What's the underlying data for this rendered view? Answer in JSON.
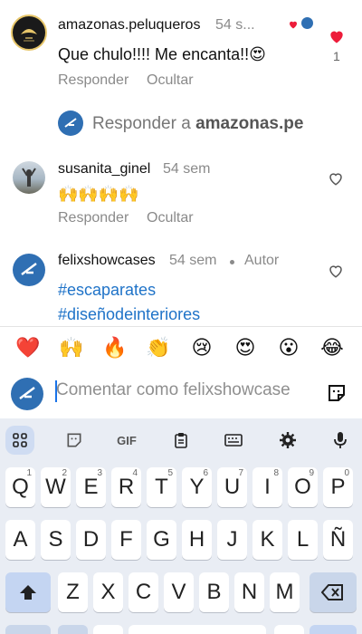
{
  "comments": [
    {
      "username": "amazonas.peluqueros",
      "time": "54 s...",
      "text": "Que chulo!!!! Me encanta!!😍",
      "actions": [
        "Responder",
        "Ocultar"
      ],
      "like_count": "1",
      "liked": true
    },
    {
      "username": "susanita_ginel",
      "time": "54 sem",
      "text": "🙌🙌🙌🙌",
      "actions": [
        "Responder",
        "Ocultar"
      ]
    },
    {
      "username": "felixshowcases",
      "time": "54 sem",
      "badge": "Autor",
      "hashtags": [
        "#escaparates",
        "#diseñodeinteriores"
      ]
    }
  ],
  "reply_prompt": {
    "prefix": "Responder a ",
    "target": "amazonas.pe"
  },
  "emoji_bar": [
    "❤️",
    "🙌",
    "🔥",
    "👏",
    "😢",
    "😍",
    "😮",
    "😂"
  ],
  "compose": {
    "placeholder": "Comentar como felixshowcase"
  },
  "keyboard": {
    "toolbar": [
      "apps-grid-icon",
      "sticker-icon",
      "gif-icon",
      "clipboard-icon",
      "keyboard-icon",
      "settings-icon",
      "mic-icon"
    ],
    "gif_label": "GIF",
    "row1": [
      {
        "k": "Q",
        "n": "1"
      },
      {
        "k": "W",
        "n": "2"
      },
      {
        "k": "E",
        "n": "3"
      },
      {
        "k": "R",
        "n": "4"
      },
      {
        "k": "T",
        "n": "5"
      },
      {
        "k": "Y",
        "n": "6"
      },
      {
        "k": "U",
        "n": "7"
      },
      {
        "k": "I",
        "n": "8"
      },
      {
        "k": "O",
        "n": "9"
      },
      {
        "k": "P",
        "n": "0"
      }
    ],
    "row2": [
      "A",
      "S",
      "D",
      "F",
      "G",
      "H",
      "J",
      "K",
      "L",
      "Ñ"
    ],
    "row3": [
      "Z",
      "X",
      "C",
      "V",
      "B",
      "N",
      "M"
    ]
  },
  "colors": {
    "accent": "#1a73e8",
    "heart": "#ed1c3a",
    "hashtag": "#1f73c8",
    "keyboard_bg": "#e9edf4"
  }
}
